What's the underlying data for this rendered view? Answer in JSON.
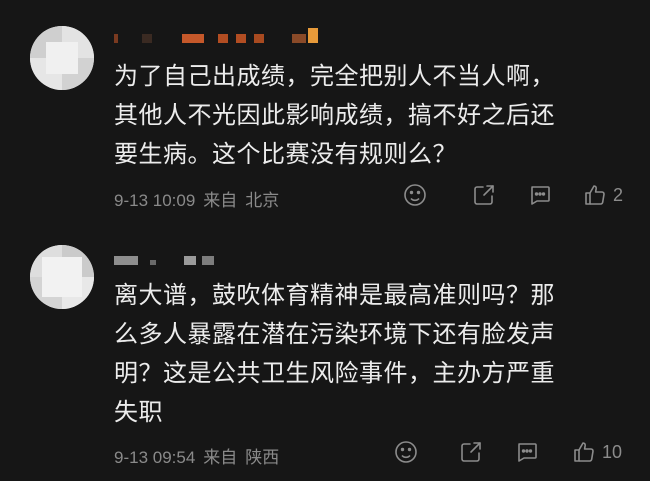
{
  "comments": [
    {
      "username": "",
      "text_lines": [
        "为了自己出成绩，完全把别人不当人啊，",
        "其他人不光因此影响成绩，搞不好之后还",
        "要生病。这个比赛没有规则么？"
      ],
      "date": "9-13 10:09",
      "source_prefix": "来自",
      "location": "北京",
      "like_count": "2"
    },
    {
      "username": "",
      "text_lines": [
        "离大谱，鼓吹体育精神是最高准则吗？那",
        "么多人暴露在潜在污染环境下还有脸发声",
        "明？这是公共卫生风险事件，主办方严重",
        "失职"
      ],
      "date": "9-13 09:54",
      "source_prefix": "来自",
      "location": "陕西",
      "like_count": "10"
    }
  ],
  "colors": {
    "background": "#161616",
    "text": "#ececec",
    "meta": "#8a8a8a",
    "icon": "#8c8c8c"
  },
  "icons": [
    "avatar",
    "emoji-icon",
    "share-icon",
    "comment-icon",
    "like-icon"
  ]
}
